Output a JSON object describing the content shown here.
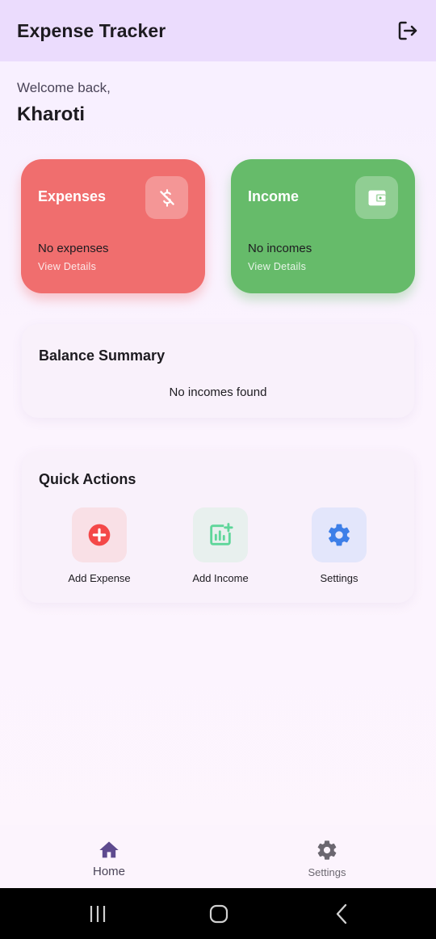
{
  "appbar": {
    "title": "Expense Tracker",
    "logout_icon": "logout-icon"
  },
  "greeting": {
    "welcome": "Welcome back,",
    "username": "Kharoti"
  },
  "cards": {
    "expenses": {
      "title": "Expenses",
      "status": "No expenses",
      "link": "View Details",
      "color": "#f06e6e",
      "icon": "money-off-icon"
    },
    "income": {
      "title": "Income",
      "status": "No incomes",
      "link": "View Details",
      "color": "#66bb6a",
      "icon": "wallet-icon"
    }
  },
  "balance": {
    "title": "Balance Summary",
    "empty_text": "No incomes found"
  },
  "quick_actions": {
    "title": "Quick Actions",
    "items": [
      {
        "label": "Add Expense",
        "icon": "add-circle-icon",
        "color": "#f44848"
      },
      {
        "label": "Add Income",
        "icon": "add-chart-icon",
        "color": "#5fd69a"
      },
      {
        "label": "Settings",
        "icon": "gear-icon",
        "color": "#3d7fe8"
      }
    ]
  },
  "bottom_nav": {
    "items": [
      {
        "label": "Home",
        "icon": "home-icon",
        "active": true
      },
      {
        "label": "Settings",
        "icon": "gear-icon",
        "active": false
      }
    ]
  },
  "system_nav": {
    "recents": "recents-icon",
    "home": "home-button-icon",
    "back": "back-icon"
  }
}
